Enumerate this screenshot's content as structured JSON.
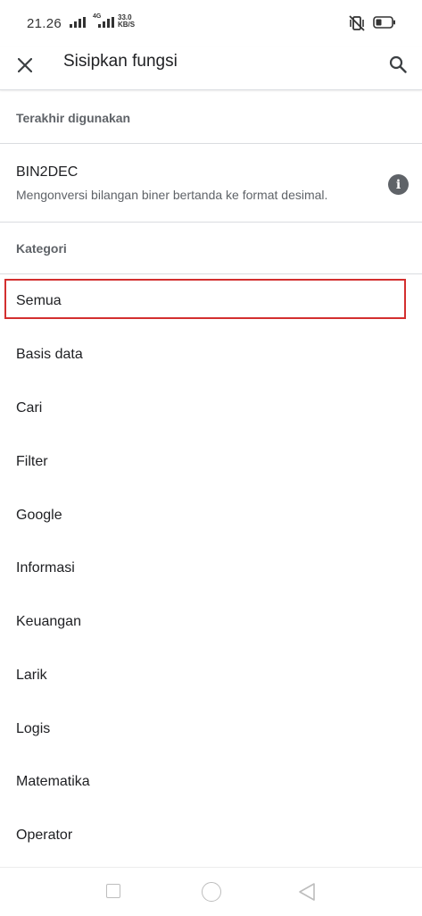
{
  "status_bar": {
    "time": "21.26",
    "network": "4G",
    "speed_value": "33.0",
    "speed_unit": "KB/S"
  },
  "app_bar": {
    "title": "Sisipkan fungsi",
    "close_icon": "close-icon",
    "search_icon": "search-icon"
  },
  "recent": {
    "header": "Terakhir digunakan",
    "items": [
      {
        "name": "BIN2DEC",
        "description": "Mengonversi bilangan biner bertanda ke format desimal.",
        "icon": "info-icon"
      }
    ]
  },
  "categories": {
    "header": "Kategori",
    "items": [
      {
        "label": "Semua"
      },
      {
        "label": "Basis data"
      },
      {
        "label": "Cari"
      },
      {
        "label": "Filter"
      },
      {
        "label": "Google"
      },
      {
        "label": "Informasi"
      },
      {
        "label": "Keuangan"
      },
      {
        "label": "Larik"
      },
      {
        "label": "Logis"
      },
      {
        "label": "Matematika"
      },
      {
        "label": "Operator"
      }
    ]
  },
  "colors": {
    "highlight": "#d32f2f",
    "text_primary": "#202124",
    "text_secondary": "#5f6368",
    "divider": "#dadce0"
  }
}
